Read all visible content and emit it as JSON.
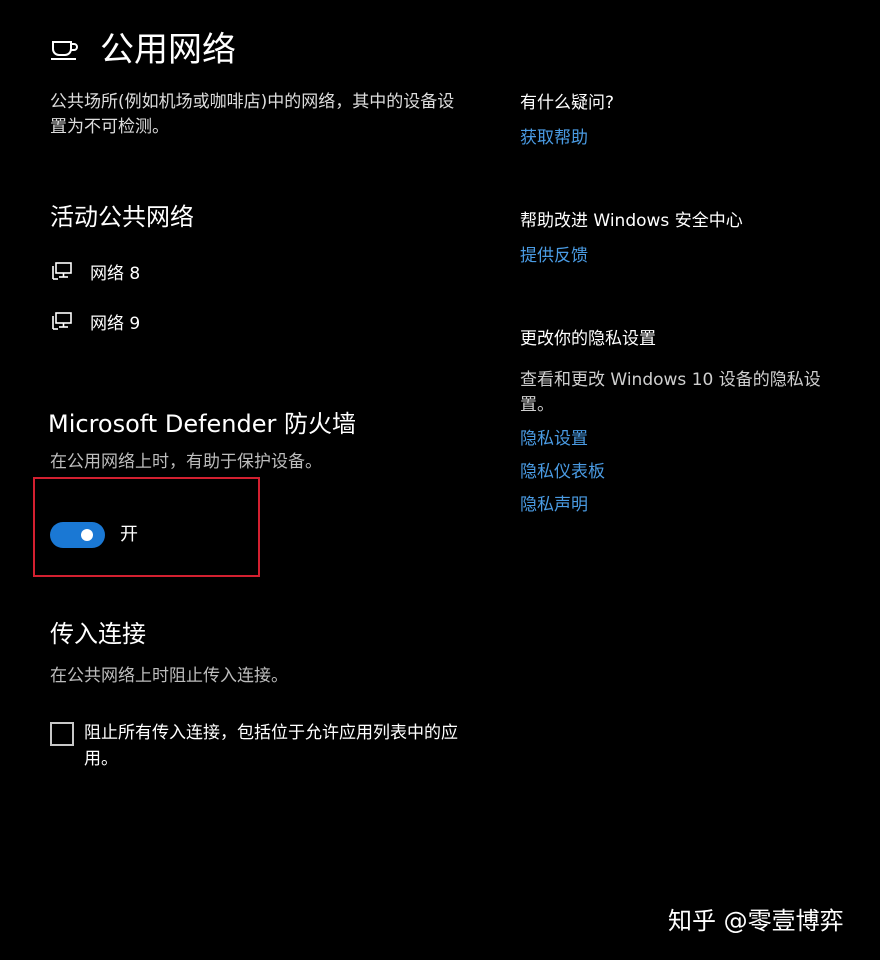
{
  "header": {
    "title": "公用网络",
    "icon": "coffee-cup-icon",
    "description": "公共场所(例如机场或咖啡店)中的网络，其中的设备设置为不可检测。"
  },
  "active_networks": {
    "title": "活动公共网络",
    "items": [
      {
        "label": "网络 8",
        "icon": "network-monitor-icon"
      },
      {
        "label": "网络 9",
        "icon": "network-monitor-icon"
      }
    ]
  },
  "firewall": {
    "title": "Microsoft Defender 防火墙",
    "description": "在公用网络上时，有助于保护设备。",
    "toggle_state": "on",
    "toggle_label": "开",
    "toggle_color": "#1a78d4",
    "highlight_color": "#d32030"
  },
  "incoming": {
    "title": "传入连接",
    "description": "在公共网络上时阻止传入连接。",
    "checkbox_checked": false,
    "checkbox_label": "阻止所有传入连接，包括位于允许应用列表中的应用。"
  },
  "sidebar": {
    "help": {
      "heading": "有什么疑问?",
      "link": "获取帮助"
    },
    "feedback": {
      "heading": "帮助改进 Windows 安全中心",
      "link": "提供反馈"
    },
    "privacy": {
      "heading": "更改你的隐私设置",
      "text": "查看和更改 Windows 10 设备的隐私设置。",
      "links": [
        "隐私设置",
        "隐私仪表板",
        "隐私声明"
      ]
    },
    "link_color": "#4a9be3"
  },
  "watermark": "知乎 @零壹博弈"
}
